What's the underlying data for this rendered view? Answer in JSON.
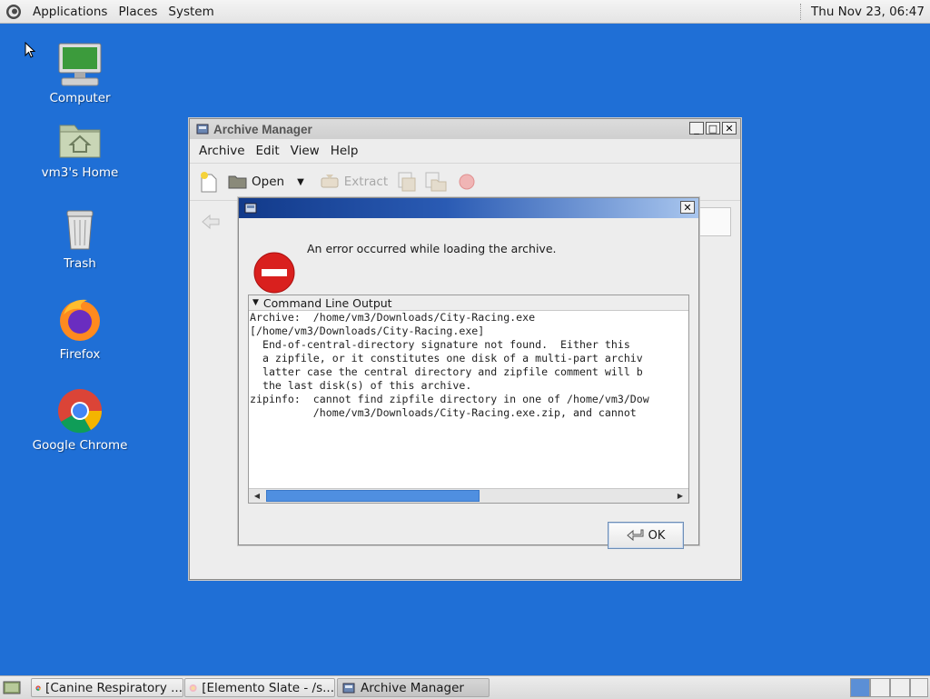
{
  "top_panel": {
    "menus": [
      "Applications",
      "Places",
      "System"
    ],
    "clock": "Thu Nov 23, 06:47"
  },
  "desktop_icons": [
    {
      "label": "Computer",
      "icon": "computer-icon"
    },
    {
      "label": "vm3's Home",
      "icon": "home-folder-icon"
    },
    {
      "label": "Trash",
      "icon": "trash-icon"
    },
    {
      "label": "Firefox",
      "icon": "firefox-icon"
    },
    {
      "label": "Google Chrome",
      "icon": "chrome-icon"
    }
  ],
  "archive_window": {
    "title": "Archive Manager",
    "menus": [
      "Archive",
      "Edit",
      "View",
      "Help"
    ],
    "toolbar": {
      "open": "Open",
      "extract": "Extract"
    }
  },
  "error_dialog": {
    "message": "An error occurred while loading the archive.",
    "expander_label": "Command Line Output",
    "output": "Archive:  /home/vm3/Downloads/City-Racing.exe\n[/home/vm3/Downloads/City-Racing.exe]\n  End-of-central-directory signature not found.  Either this\n  a zipfile, or it constitutes one disk of a multi-part archiv\n  latter case the central directory and zipfile comment will b\n  the last disk(s) of this archive.\nzipinfo:  cannot find zipfile directory in one of /home/vm3/Dow\n          /home/vm3/Downloads/City-Racing.exe.zip, and cannot",
    "ok_label": "OK",
    "scroll_fraction": 0.48
  },
  "taskbar": {
    "tasks": [
      {
        "label": "[Canine Respiratory ...",
        "icon": "chrome-icon"
      },
      {
        "label": "[Elemento Slate - /s...",
        "icon": "browser-icon"
      },
      {
        "label": "Archive Manager",
        "icon": "archive-manager-icon"
      }
    ]
  },
  "colors": {
    "desktop": "#1f6fd6",
    "error_red": "#d9201e",
    "selection_blue": "#4f8fe0"
  }
}
